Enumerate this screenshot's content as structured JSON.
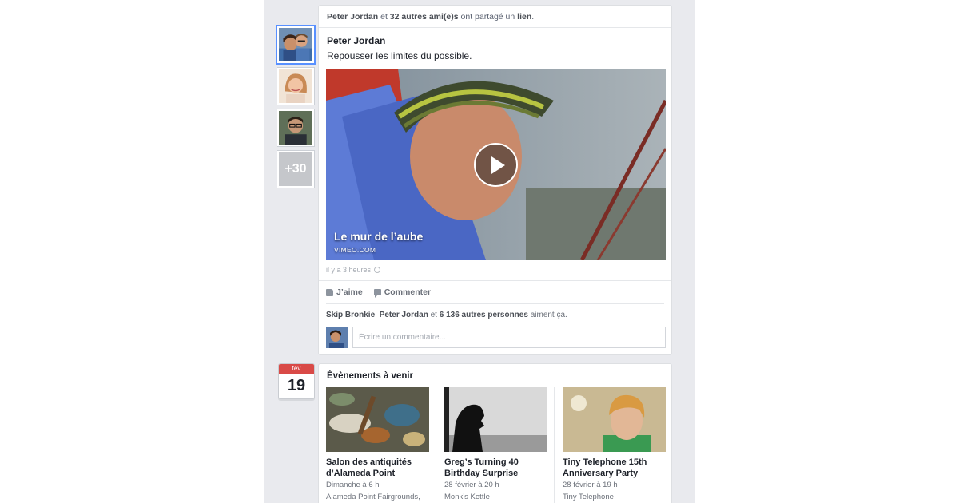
{
  "colors": {
    "feed_bg": "#e9eaee",
    "accent": "#5890ff",
    "calendar_red": "#d94a47"
  },
  "friends": {
    "thumbnails": [
      {
        "icon": "couple-photo"
      },
      {
        "icon": "woman-photo"
      },
      {
        "icon": "man-glasses-photo"
      }
    ],
    "more_count": "+30"
  },
  "post": {
    "share_header": {
      "actor": "Peter Jordan",
      "conj": " et ",
      "others": "32 autres ami(e)s",
      "verb": " ont partagé un ",
      "object": "lien",
      "end": "."
    },
    "author": "Peter Jordan",
    "text": "Repousser les limites du possible.",
    "video": {
      "title": "Le mur de l’aube",
      "source": "VIMEO.COM",
      "icon": "play-icon"
    },
    "timestamp": "il y a 3 heures",
    "actions": {
      "like": "J’aime",
      "comment": "Commenter"
    },
    "likes": {
      "name1": "Skip Bronkie",
      "sep": ", ",
      "name2": "Peter Jordan",
      "conj": " et ",
      "others": "6 136 autres personnes",
      "tail": " aiment ça."
    },
    "comment_placeholder": "Écrire un commentaire..."
  },
  "calendar": {
    "month": "fév",
    "day": "19"
  },
  "events": {
    "title": "Évènements à venir",
    "items": [
      {
        "name": "Salon des antiquités d’Alameda Point",
        "date": "Dimanche à 6 h",
        "venue": "Alameda Point Fairgrounds,"
      },
      {
        "name": "Greg’s Turning 40 Birthday Surprise",
        "date": "28 février à 20 h",
        "venue": "Monk’s Kettle"
      },
      {
        "name": "Tiny Telephone 15th Anniversary Party",
        "date": "28 février à 19 h",
        "venue": "Tiny Telephone"
      }
    ]
  }
}
